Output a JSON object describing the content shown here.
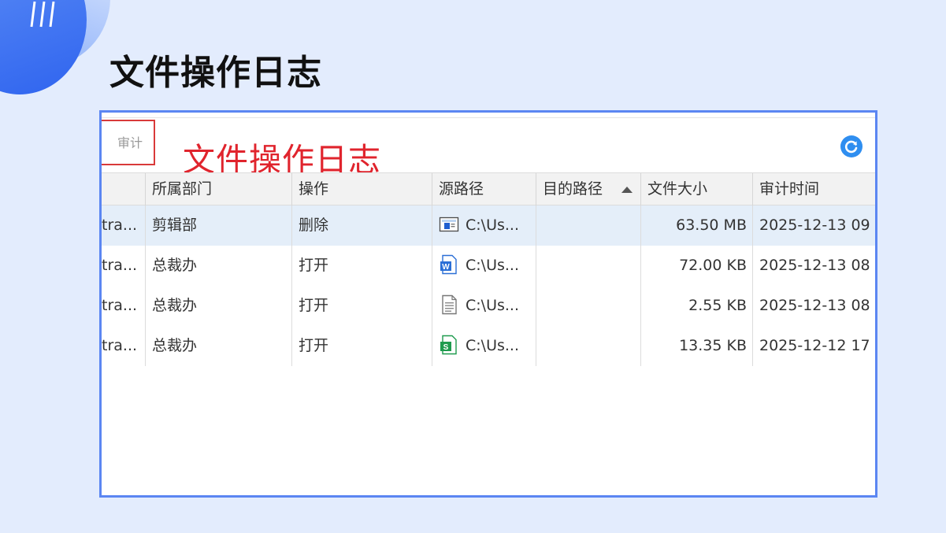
{
  "page": {
    "title": "文件操作日志"
  },
  "frame": {
    "cropped_tab_label": "审计",
    "caption": "文件操作日志"
  },
  "icons": {
    "refresh": "refresh-icon",
    "sort": "sort-ascending-icon"
  },
  "colors": {
    "frame_border": "#5b86f2",
    "caption": "#e0242d",
    "refresh": "#2f8ef0",
    "selected_row": "#e4eef9"
  },
  "table": {
    "columns": [
      {
        "label": ""
      },
      {
        "label": "所属部门"
      },
      {
        "label": "操作"
      },
      {
        "label": "源路径"
      },
      {
        "label": "目的路径",
        "sorted": "ascending"
      },
      {
        "label": "文件大小"
      },
      {
        "label": "审计时间"
      }
    ],
    "rows": [
      {
        "user": "tra...",
        "dept": "剪辑部",
        "op": "删除",
        "src_icon": "image-file-icon",
        "src": "C:\\Us...",
        "dst": "",
        "size": "63.50 MB",
        "time": "2025-12-13 09",
        "selected": true
      },
      {
        "user": "tra...",
        "dept": "总裁办",
        "op": "打开",
        "src_icon": "word-file-icon",
        "src": "C:\\Us...",
        "dst": "",
        "size": "72.00 KB",
        "time": "2025-12-13 08",
        "selected": false
      },
      {
        "user": "tra...",
        "dept": "总裁办",
        "op": "打开",
        "src_icon": "text-file-icon",
        "src": "C:\\Us...",
        "dst": "",
        "size": "2.55 KB",
        "time": "2025-12-13 08",
        "selected": false
      },
      {
        "user": "tra...",
        "dept": "总裁办",
        "op": "打开",
        "src_icon": "spreadsheet-file-icon",
        "src": "C:\\Us...",
        "dst": "",
        "size": "13.35 KB",
        "time": "2025-12-12 17",
        "selected": false
      }
    ]
  }
}
